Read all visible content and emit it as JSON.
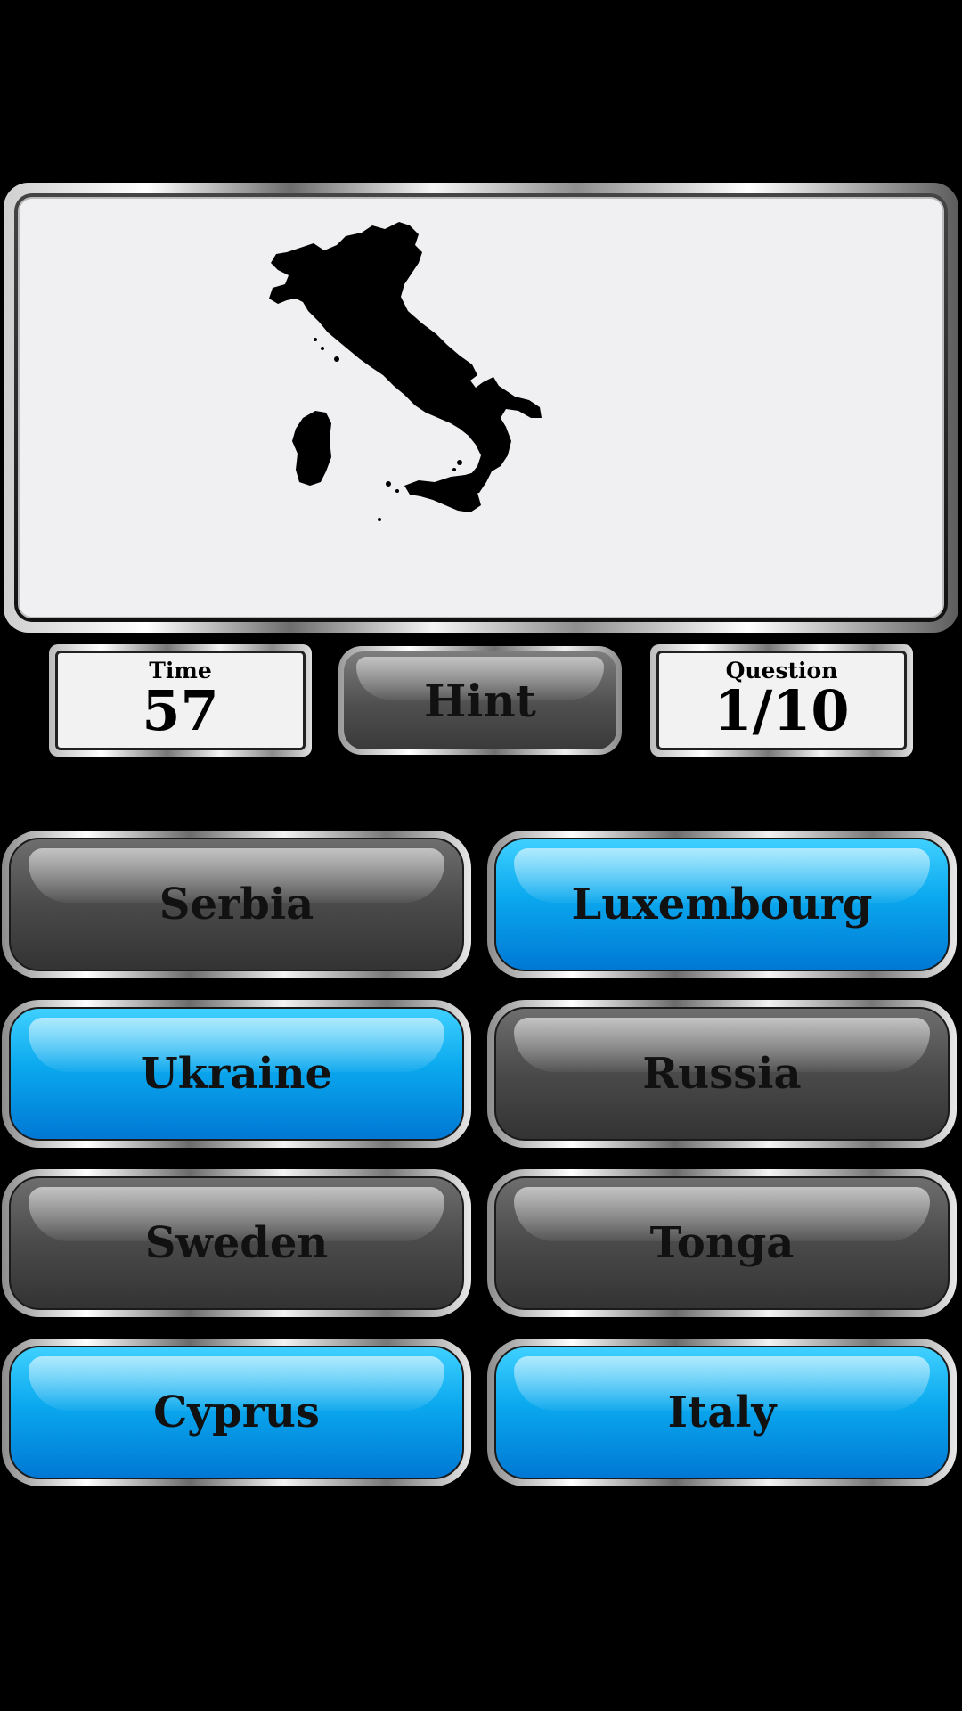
{
  "map": {
    "country_silhouette": "italy-map-icon",
    "background_color": "#f0f0f2"
  },
  "stats": {
    "time_label": "Time",
    "time_value": "57",
    "question_label": "Question",
    "question_value": "1/10"
  },
  "hint": {
    "label": "Hint"
  },
  "answers": [
    {
      "label": "Serbia",
      "style": "gray"
    },
    {
      "label": "Luxembourg",
      "style": "blue"
    },
    {
      "label": "Ukraine",
      "style": "blue"
    },
    {
      "label": "Russia",
      "style": "gray"
    },
    {
      "label": "Sweden",
      "style": "gray"
    },
    {
      "label": "Tonga",
      "style": "gray"
    },
    {
      "label": "Cyprus",
      "style": "blue"
    },
    {
      "label": "Italy",
      "style": "blue"
    }
  ],
  "colors": {
    "background": "#000000",
    "button_gray": "#4a4a4a",
    "button_blue": "#0aa8ee"
  }
}
